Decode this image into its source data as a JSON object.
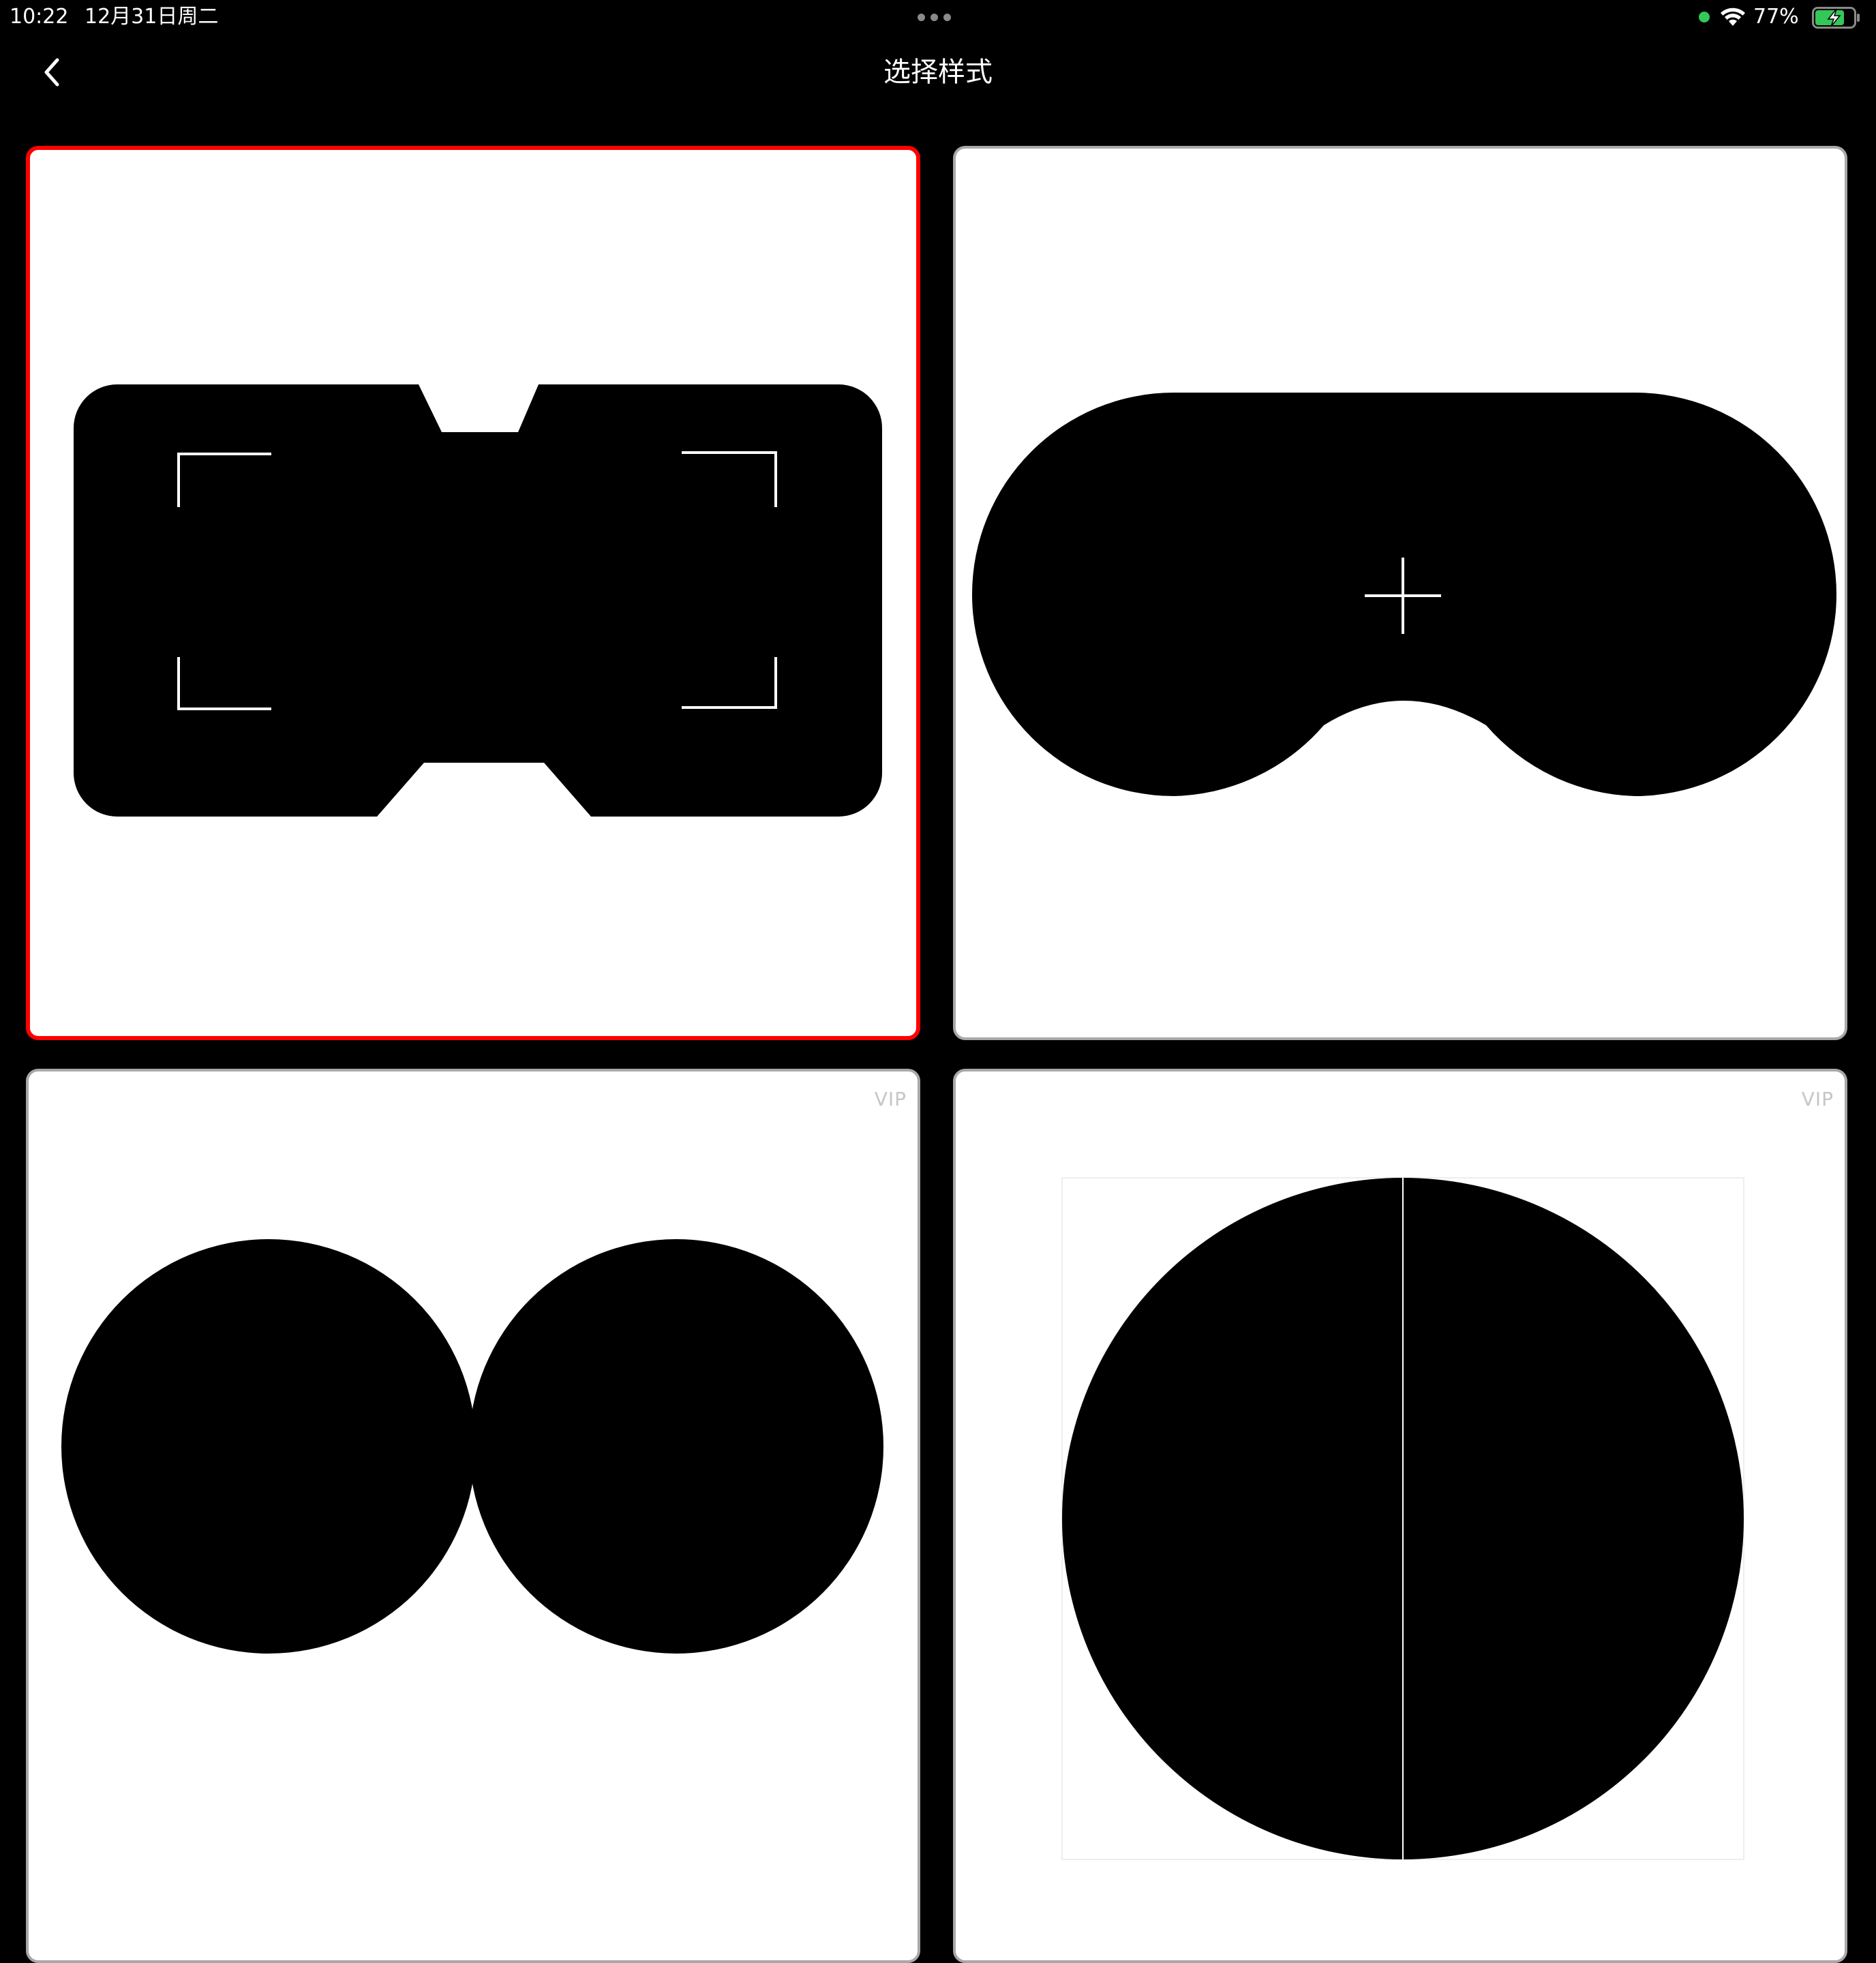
{
  "status_bar": {
    "time": "10:22",
    "date": "12月31日周二",
    "battery_percent": "77%",
    "battery_level": 0.77,
    "charging": true,
    "camera_indicator_color": "#34c759"
  },
  "nav": {
    "title": "选择样式",
    "back_icon": "chevron-left-icon"
  },
  "styles": [
    {
      "name": "notched-rectangle-with-corner-brackets",
      "selected": true,
      "vip": ""
    },
    {
      "name": "oval-mask-with-crosshair",
      "selected": false,
      "vip": ""
    },
    {
      "name": "twin-circles",
      "selected": false,
      "vip": "VIP"
    },
    {
      "name": "split-circle",
      "selected": false,
      "vip": "VIP"
    }
  ],
  "colors": {
    "background": "#000000",
    "card_background": "#ffffff",
    "selected_border": "#ff0000",
    "card_border": "#a8a8a8",
    "vip_text": "#c6c6c6"
  }
}
